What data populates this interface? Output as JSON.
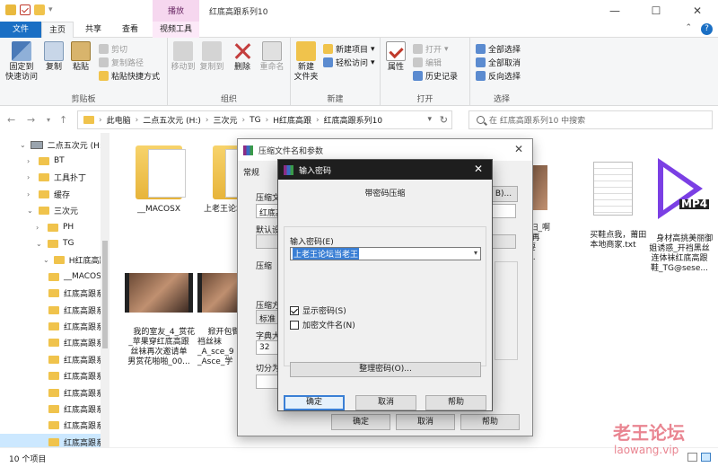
{
  "window": {
    "title": "红底高跟系列10",
    "context_tab": "播放",
    "min_icon": "minimize-icon",
    "max_icon": "maximize-icon",
    "close_icon": "close-icon"
  },
  "ribbon_tabs": [
    "文件",
    "主页",
    "共享",
    "查看",
    "视频工具"
  ],
  "ribbon": {
    "clipboard": {
      "label": "剪贴板",
      "pin": "固定到\n快速访问",
      "copy": "复制",
      "paste": "粘贴",
      "cut": "剪切",
      "copy_path": "复制路径",
      "paste_shortcut": "粘贴快捷方式"
    },
    "organize": {
      "label": "组织",
      "move_to": "移动到",
      "copy_to": "复制到",
      "delete": "删除",
      "rename": "重命名"
    },
    "new": {
      "label": "新建",
      "new_folder": "新建\n文件夹",
      "new_item": "新建项目",
      "easy_access": "轻松访问"
    },
    "open": {
      "label": "打开",
      "properties": "属性",
      "open": "打开",
      "edit": "编辑",
      "history": "历史记录"
    },
    "select": {
      "label": "选择",
      "select_all": "全部选择",
      "select_none": "全部取消",
      "invert": "反向选择"
    }
  },
  "address": {
    "crumbs": [
      "此电脑",
      "二点五次元 (H:)",
      "三次元",
      "TG",
      "H红底高跟",
      "红底高跟系列10"
    ],
    "search_placeholder": "在 红底高跟系列10 中搜索"
  },
  "sidebar": {
    "items": [
      {
        "label": "二点五次元 (H:)",
        "type": "drive",
        "indent": 0
      },
      {
        "label": "BT",
        "type": "folder",
        "indent": 1
      },
      {
        "label": "工具扑丁",
        "type": "folder",
        "indent": 1
      },
      {
        "label": "缓存",
        "type": "folder",
        "indent": 1
      },
      {
        "label": "三次元",
        "type": "folder",
        "indent": 1
      },
      {
        "label": "PH",
        "type": "folder",
        "indent": 2
      },
      {
        "label": "TG",
        "type": "folder",
        "indent": 2
      },
      {
        "label": "H红底高跟",
        "type": "folder",
        "indent": 3
      },
      {
        "label": "__MACOS",
        "type": "folder",
        "indent": 4
      },
      {
        "label": "红底高跟系",
        "type": "folder",
        "indent": 4
      },
      {
        "label": "红底高跟系",
        "type": "folder",
        "indent": 4
      },
      {
        "label": "红底高跟系",
        "type": "folder",
        "indent": 4
      },
      {
        "label": "红底高跟系",
        "type": "folder",
        "indent": 4
      },
      {
        "label": "红底高跟系",
        "type": "folder",
        "indent": 4
      },
      {
        "label": "红底高跟系",
        "type": "folder",
        "indent": 4
      },
      {
        "label": "红底高跟系",
        "type": "folder",
        "indent": 4
      },
      {
        "label": "红底高跟系",
        "type": "folder",
        "indent": 4
      },
      {
        "label": "红底高跟系",
        "type": "folder",
        "indent": 4
      },
      {
        "label": "红底高跟系",
        "type": "folder",
        "indent": 4
      }
    ]
  },
  "files": [
    {
      "name": "__MACOSX",
      "kind": "folder"
    },
    {
      "name": "上老王论坛当老王",
      "kind": "folder"
    },
    {
      "name": "少妇_啊\n用力_再\n要还要\n被无...",
      "kind": "video"
    },
    {
      "name": "买鞋点我，莆田\n本地商家.txt",
      "kind": "txt"
    },
    {
      "name": "身材高挑美丽御\n姐诱惑_开裆黑丝\n连体袜红底高跟\n鞋_TG@sese...",
      "kind": "mp4"
    },
    {
      "name": "我的室友_4_赏花\n_苹果穿红底高跟\n丝袜再次邀请单\n男赏花啪啪_00...",
      "kind": "video"
    },
    {
      "name": "掀开包臀\n裆丝袜\n_A_sce_9\n_Asce_学",
      "kind": "video"
    }
  ],
  "status": {
    "count": "10 个项目"
  },
  "archive_dialog": {
    "title": "压缩文件名和参数",
    "tab": "常规",
    "name_label": "压缩文",
    "name_value": "红底高",
    "browse": "B)...",
    "profile_label": "默认设",
    "format_label": "压缩",
    "method_label": "压缩方",
    "method_value": "标准",
    "dict_label": "字典大",
    "dict_value": "32",
    "split_label": "切分为",
    "ok": "确定",
    "cancel": "取消",
    "help": "帮助"
  },
  "password_dialog": {
    "title": "输入密码",
    "heading": "带密码压缩",
    "pw_label": "输入密码(E)",
    "pw_value": "上老王论坛当老王",
    "show_password": "显示密码(S)",
    "encrypt_names": "加密文件名(N)",
    "organize": "整理密码(O)...",
    "ok": "确定",
    "cancel": "取消",
    "help": "帮助"
  },
  "watermark": {
    "line1": "老王论坛",
    "line2": "laowang.vip"
  }
}
